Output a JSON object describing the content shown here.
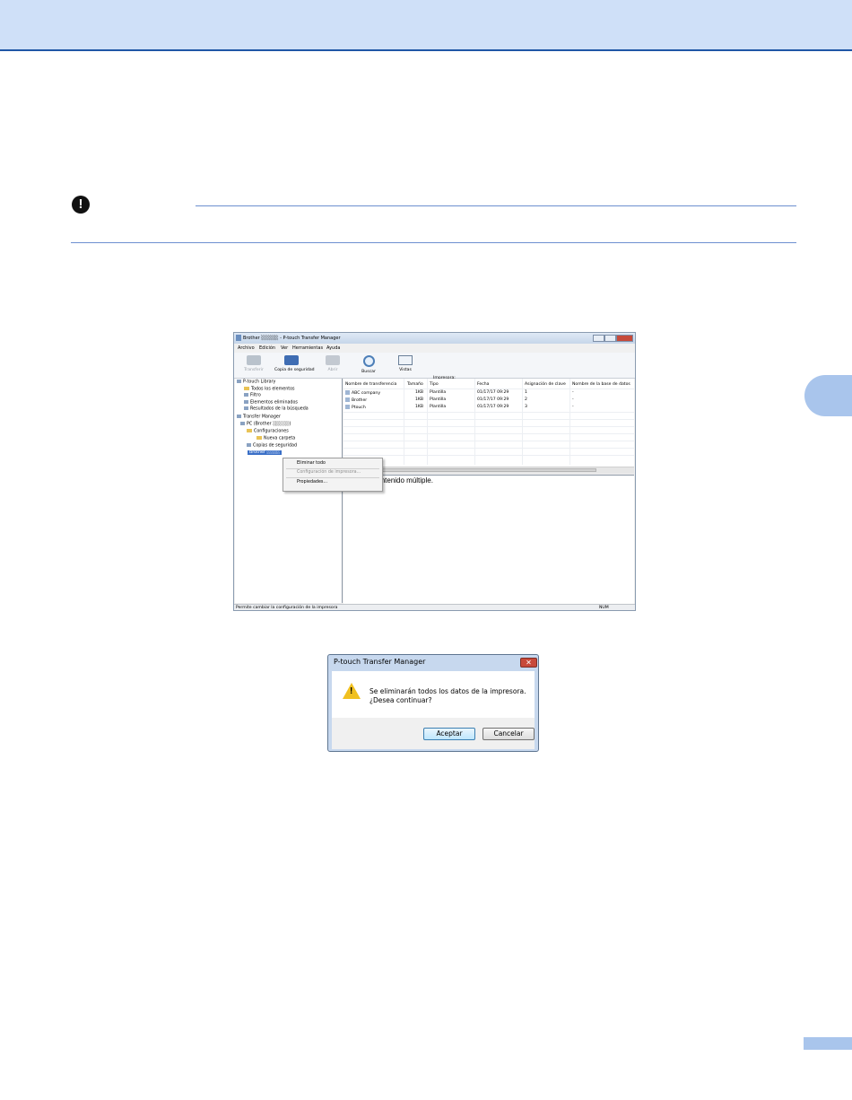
{
  "header_band": {
    "color": "#cfe0f8",
    "line_color": "#1f57a6"
  },
  "important_icon": "!",
  "app": {
    "title": "Brother ░░░░░ - P-touch Transfer Manager",
    "menu": [
      "Archivo",
      "Edición",
      "Ver",
      "Herramientas",
      "Ayuda"
    ],
    "toolbar": [
      {
        "label": "Transferir",
        "icon": "transfer-icon",
        "disabled": true
      },
      {
        "label": "Copia de seguridad",
        "icon": "backup-icon",
        "disabled": false
      },
      {
        "label": "Abrir",
        "icon": "open-icon",
        "disabled": true
      },
      {
        "label": "Buscar",
        "icon": "search-icon",
        "disabled": false
      },
      {
        "label": "Vistas",
        "icon": "views-icon",
        "disabled": false
      }
    ],
    "printer_label": "Impresora:",
    "printer_value": "Brother ░░░░░",
    "tree": [
      "P-touch Library",
      "Todos los elementos",
      "Filtro",
      "Elementos eliminados",
      "Resultados de la búsqueda",
      "Transfer Manager",
      "PC (Brother ░░░░░)",
      "Configuraciones",
      "Nueva carpeta",
      "Copias de seguridad",
      "Brother ░░░░"
    ],
    "columns": [
      "Nombre de transferencia",
      "Tamaño",
      "Tipo",
      "Fecha",
      "Asignación de clave",
      "Nombre de la base de datos"
    ],
    "rows": [
      [
        "ABC company",
        "1KB",
        "Plantilla",
        "01/17/17 09:29",
        "1",
        "-"
      ],
      [
        "Brother",
        "1KB",
        "Plantilla",
        "01/17/17 09:29",
        "2",
        "-"
      ],
      [
        "Ptouch",
        "1KB",
        "Plantilla",
        "01/17/17 09:29",
        "3",
        "-"
      ]
    ],
    "preview_text": "cionado contenido múltiple.",
    "context_menu": [
      "Eliminar todo",
      "Configuración de impresora...",
      "Propiedades..."
    ],
    "status_left": "Permite cambiar la configuración de la impresora",
    "status_right": "NUM"
  },
  "dialog": {
    "title": "P-touch Transfer Manager",
    "message_line1": "Se eliminarán todos los datos de la impresora.",
    "message_line2": "¿Desea continuar?",
    "ok": "Aceptar",
    "cancel": "Cancelar",
    "close": "✕",
    "warn_glyph": "!"
  }
}
